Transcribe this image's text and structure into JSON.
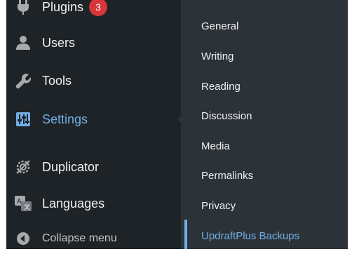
{
  "menu": {
    "plugins": {
      "label": "Plugins",
      "badge": "3"
    },
    "users": {
      "label": "Users"
    },
    "tools": {
      "label": "Tools"
    },
    "settings": {
      "label": "Settings"
    },
    "duplicator": {
      "label": "Duplicator"
    },
    "languages": {
      "label": "Languages"
    },
    "collapse": {
      "label": "Collapse menu"
    }
  },
  "submenu": {
    "items": [
      {
        "label": "General"
      },
      {
        "label": "Writing"
      },
      {
        "label": "Reading"
      },
      {
        "label": "Discussion"
      },
      {
        "label": "Media"
      },
      {
        "label": "Permalinks"
      },
      {
        "label": "Privacy"
      },
      {
        "label": "UpdraftPlus Backups"
      }
    ]
  },
  "colors": {
    "menu_bg": "#1d2327",
    "submenu_bg": "#2c3338",
    "accent": "#72aee6",
    "badge": "#d63638"
  }
}
